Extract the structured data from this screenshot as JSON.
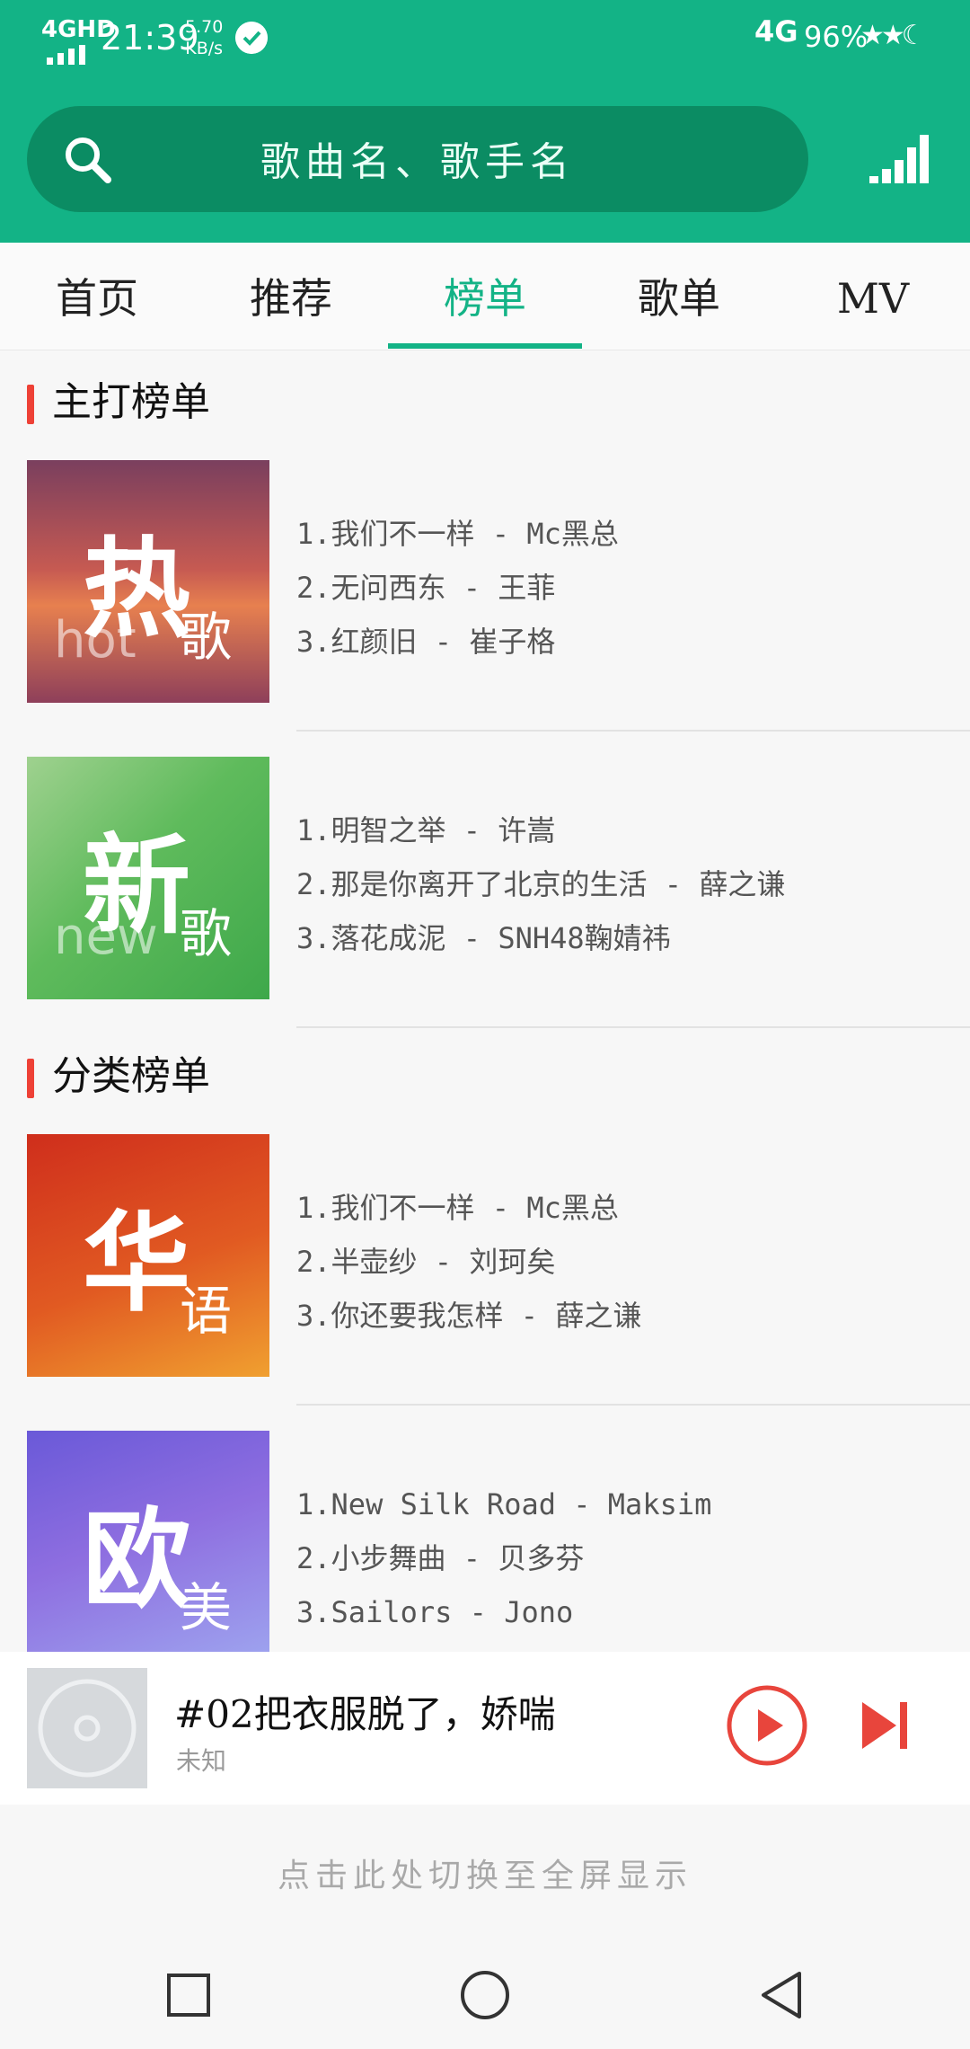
{
  "status_bar": {
    "network": "4GHD",
    "time": "21:39",
    "speed_value": "5.70",
    "speed_unit": "KB/s",
    "network_type": "4G",
    "battery": "96%"
  },
  "search": {
    "placeholder": "歌曲名、歌手名"
  },
  "tabs": [
    {
      "label": "首页",
      "active": false
    },
    {
      "label": "推荐",
      "active": false
    },
    {
      "label": "榜单",
      "active": true
    },
    {
      "label": "歌单",
      "active": false
    },
    {
      "label": "MV",
      "active": false
    }
  ],
  "sections": {
    "main": {
      "title": "主打榜单"
    },
    "category": {
      "title": "分类榜单"
    }
  },
  "charts": [
    {
      "cover_big": "热",
      "cover_small": "歌",
      "cover_eng": "hot",
      "songs": [
        "1.我们不一样 - Mc黑总",
        "2.无问西东 - 王菲",
        "3.红颜旧 - 崔子格"
      ]
    },
    {
      "cover_big": "新",
      "cover_small": "歌",
      "cover_eng": "new",
      "songs": [
        "1.明智之举 - 许嵩",
        "2.那是你离开了北京的生活 - 薛之谦",
        "3.落花成泥 - SNH48鞠婧祎"
      ]
    },
    {
      "cover_big": "华",
      "cover_small": "语",
      "cover_eng": "",
      "songs": [
        "1.我们不一样 - Mc黑总",
        "2.半壶纱 - 刘珂矣",
        "3.你还要我怎样 - 薛之谦"
      ]
    },
    {
      "cover_big": "欧",
      "cover_small": "美",
      "cover_eng": "",
      "songs": [
        "1.New Silk Road - Maksim",
        "2.小步舞曲 - 贝多芬",
        "3.Sailors - Jono"
      ]
    }
  ],
  "player": {
    "title": "#02把衣服脱了，娇喘",
    "artist": "未知"
  },
  "fullscreen_hint": "点击此处切换至全屏显示",
  "colors": {
    "accent": "#13b386",
    "search_bg": "#0b8c63",
    "red": "#ee4136"
  }
}
